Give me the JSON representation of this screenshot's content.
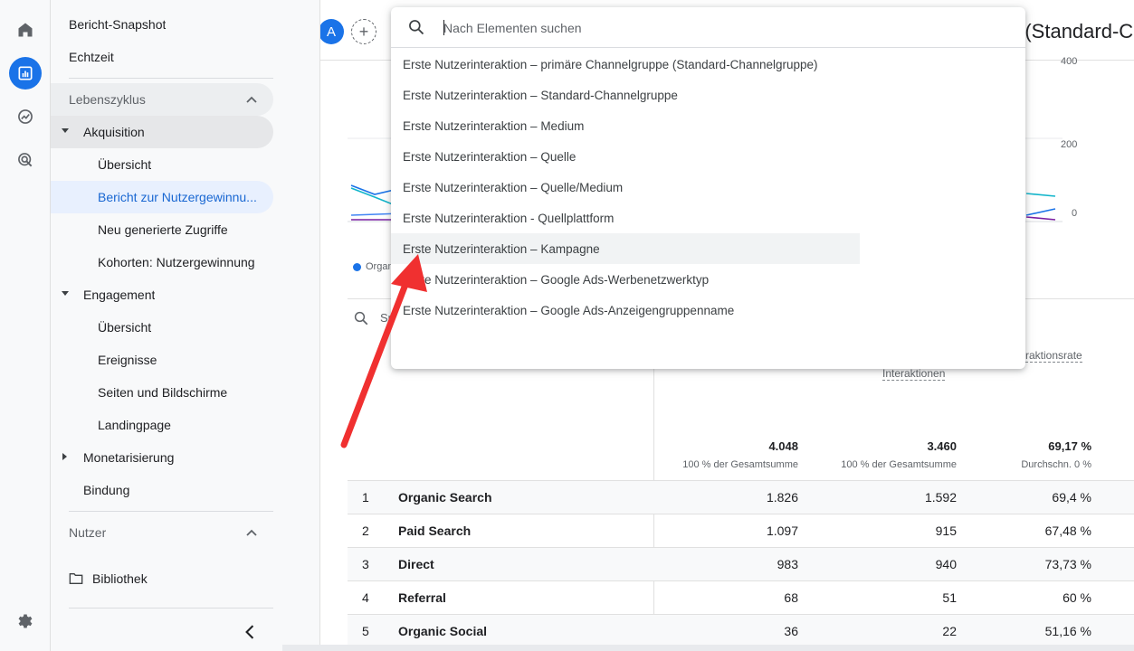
{
  "rail": {
    "icons": [
      "home-icon",
      "reports-icon",
      "explore-icon",
      "advertising-icon",
      "settings-icon"
    ]
  },
  "nav": {
    "snapshot": "Bericht-Snapshot",
    "realtime": "Echtzeit",
    "lifecycle": "Lebenszyklus",
    "acquisition": "Akquisition",
    "acq_overview": "Übersicht",
    "acq_user_report": "Bericht zur Nutzergewinnu...",
    "acq_traffic": "Neu generierte Zugriffe",
    "acq_cohorts": "Kohorten: Nutzergewinnung",
    "engagement": "Engagement",
    "eng_overview": "Übersicht",
    "eng_events": "Ereignisse",
    "eng_pages": "Seiten und Bildschirme",
    "eng_landing": "Landingpage",
    "monetization": "Monetarisierung",
    "retention": "Bindung",
    "users": "Nutzer",
    "library": "Bibliothek"
  },
  "header": {
    "avatar_letter": "A",
    "add_comparison": "+",
    "title_fragment": "e (Standard-C"
  },
  "chart": {
    "y_ticks": [
      "400",
      "200",
      "0"
    ],
    "legend_first": "Organ"
  },
  "table": {
    "search_placeholder": "Su",
    "col_interactions": "Interaktionen",
    "col_rate": "raktionsrate",
    "totals": {
      "users": "4.048",
      "users_sub": "100 % der Gesamtsumme",
      "sessions": "3.460",
      "sessions_sub": "100 % der Gesamtsumme",
      "rate": "69,17 %",
      "rate_sub": "Durchschn. 0 %"
    },
    "rows": [
      {
        "idx": "1",
        "name": "Organic Search",
        "a": "1.826",
        "b": "1.592",
        "c": "69,4 %"
      },
      {
        "idx": "2",
        "name": "Paid Search",
        "a": "1.097",
        "b": "915",
        "c": "67,48 %"
      },
      {
        "idx": "3",
        "name": "Direct",
        "a": "983",
        "b": "940",
        "c": "73,73 %"
      },
      {
        "idx": "4",
        "name": "Referral",
        "a": "68",
        "b": "51",
        "c": "60 %"
      },
      {
        "idx": "5",
        "name": "Organic Social",
        "a": "36",
        "b": "22",
        "c": "51,16 %"
      }
    ]
  },
  "dropdown": {
    "placeholder": "Nach Elementen suchen",
    "items": [
      "Erste Nutzerinteraktion – primäre Channelgruppe (Standard-Channelgruppe)",
      "Erste Nutzerinteraktion – Standard-Channelgruppe",
      "Erste Nutzerinteraktion – Medium",
      "Erste Nutzerinteraktion – Quelle",
      "Erste Nutzerinteraktion – Quelle/Medium",
      "Erste Nutzerinteraktion - Quellplattform",
      "Erste Nutzerinteraktion – Kampagne",
      "Erste Nutzerinteraktion – Google Ads-Werbenetzwerktyp",
      "Erste Nutzerinteraktion – Google Ads-Anzeigengruppenname"
    ]
  },
  "colors": {
    "accent": "#1a73e8",
    "annotation_arrow": "#f03030"
  }
}
